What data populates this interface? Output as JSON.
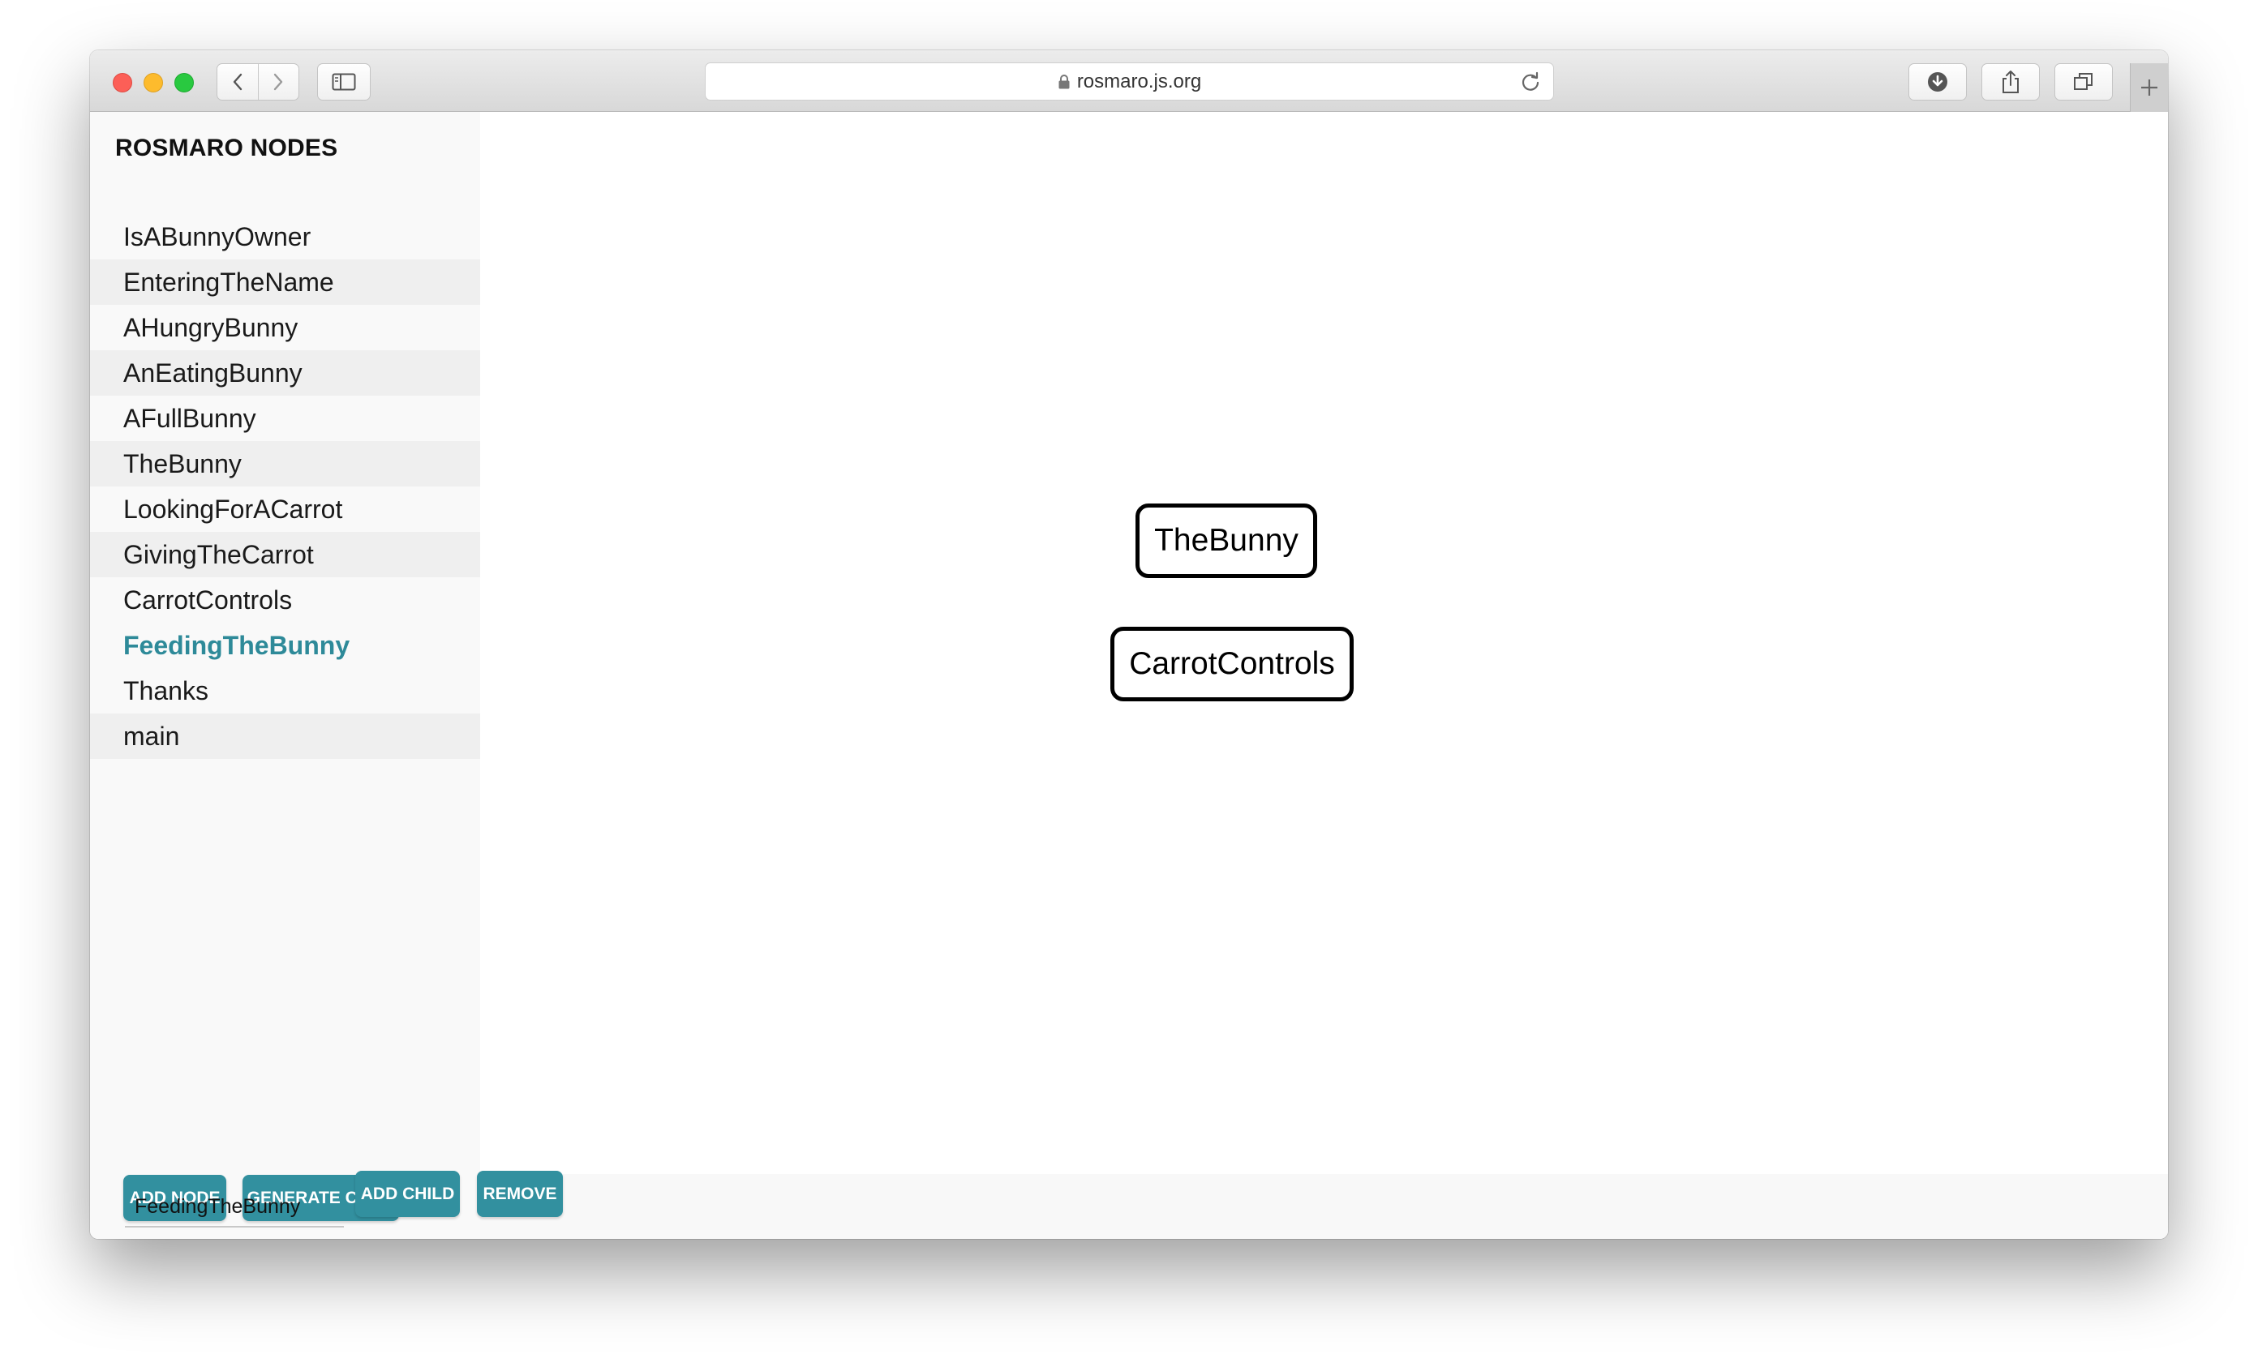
{
  "browser": {
    "url": "rosmaro.js.org"
  },
  "sidebar": {
    "title": "ROSMARO NODES",
    "nodes": [
      {
        "label": "IsABunnyOwner"
      },
      {
        "label": "EnteringTheName"
      },
      {
        "label": "AHungryBunny"
      },
      {
        "label": "AnEatingBunny"
      },
      {
        "label": "AFullBunny"
      },
      {
        "label": "TheBunny"
      },
      {
        "label": "LookingForACarrot"
      },
      {
        "label": "GivingTheCarrot"
      },
      {
        "label": "CarrotControls"
      },
      {
        "label": "FeedingTheBunny",
        "selected": true
      },
      {
        "label": "Thanks"
      },
      {
        "label": "main"
      }
    ],
    "add_node_label": "ADD NODE",
    "generate_code_label": "GENERATE CODE"
  },
  "editor": {
    "node_name_value": "FeedingTheBunny",
    "add_child_label": "ADD CHILD",
    "remove_label": "REMOVE"
  },
  "graph": {
    "nodes": [
      {
        "label": "TheBunny"
      },
      {
        "label": "CarrotControls"
      }
    ]
  },
  "colors": {
    "accent": "#32909f",
    "selected_text": "#2e8a99"
  }
}
